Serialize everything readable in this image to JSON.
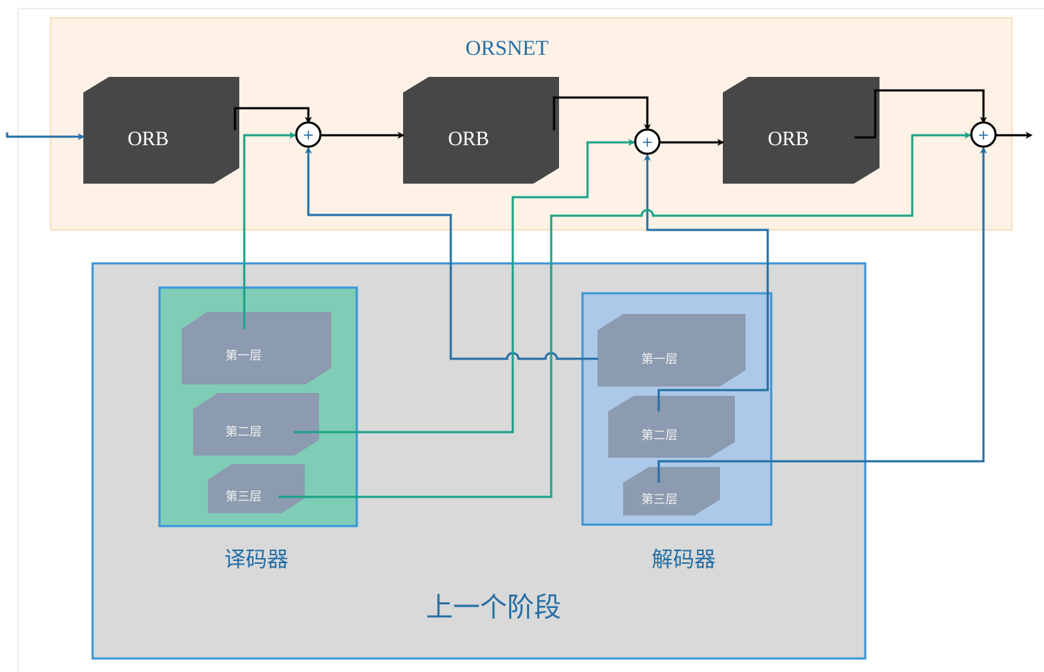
{
  "title": "ORSNET",
  "orb_blocks": [
    {
      "label": "ORB"
    },
    {
      "label": "ORB"
    },
    {
      "label": "ORB"
    }
  ],
  "sum_symbol": "+",
  "encoder": {
    "label": "译码器",
    "layers": [
      "第一层",
      "第二层",
      "第三层"
    ]
  },
  "decoder": {
    "label": "解码器",
    "layers": [
      "第一层",
      "第二层",
      "第三层"
    ]
  },
  "previous_stage_label": "上一个阶段",
  "colors": {
    "orsnet_bg": "#fef2e6",
    "orb": "#474747",
    "stage_bg": "#d9d9d9",
    "encoder_bg": "#7fcdb6",
    "decoder_bg": "#adc9e9",
    "layer": "#8c9bb0",
    "blue_line": "#246fa5",
    "green_line": "#1aa387"
  }
}
